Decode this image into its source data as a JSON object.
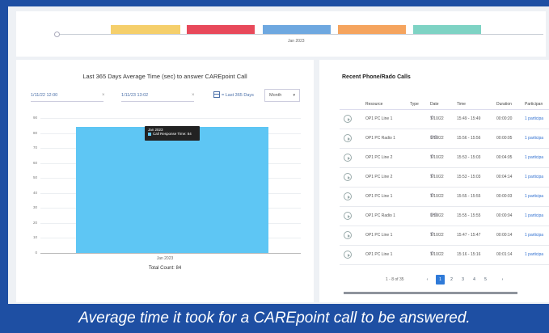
{
  "timeline": {
    "label": "Jan 2023",
    "segments": [
      "#f5cf6b",
      "#e8495a",
      "#6ea8e0",
      "#f5a45e",
      "#7ed3c4"
    ]
  },
  "chart_panel": {
    "title": "Last 365 Days Average Time (sec) to answer CAREpoint Call",
    "start_date": "1/11/22 12:00",
    "end_date": "1/11/23 13:02",
    "range_label": "Last 365 Days",
    "interval": "Month",
    "total_count": "Total Count: 84"
  },
  "chart_data": {
    "type": "bar",
    "categories": [
      "Jan 2023"
    ],
    "series": [
      {
        "name": "Call Response Time",
        "values": [
          84
        ]
      }
    ],
    "ylim": [
      0,
      90
    ],
    "yticks": [
      0,
      10,
      20,
      30,
      40,
      50,
      60,
      70,
      80,
      90
    ],
    "tooltip": {
      "title": "Jan 2023",
      "line": "Call Response Time: 84"
    },
    "bar_color": "#5ec6f4"
  },
  "calls_panel": {
    "title": "Recent Phone/Rado Calls",
    "columns": [
      "Resource",
      "Type",
      "Date",
      "Time",
      "Duration",
      "Participan"
    ],
    "rows": [
      {
        "resource": "OP1 PC Line 1",
        "type": "phone",
        "date": "1/10/22",
        "time": "15:49 - 15:49",
        "duration": "00:00:20",
        "participants": "1 participa"
      },
      {
        "resource": "OP1 PC Radio 1",
        "type": "radio",
        "date": "1/10/22",
        "time": "15:56 - 15:56",
        "duration": "00:00:05",
        "participants": "1 participa"
      },
      {
        "resource": "OP1 PC Line 2",
        "type": "phone",
        "date": "1/10/22",
        "time": "15:53 - 15:03",
        "duration": "00:04:05",
        "participants": "1 participa"
      },
      {
        "resource": "OP1 PC Line 2",
        "type": "phone",
        "date": "1/10/22",
        "time": "15:53 - 15:03",
        "duration": "00:04:14",
        "participants": "1 participa"
      },
      {
        "resource": "OP1 PC Line 1",
        "type": "phone",
        "date": "1/10/22",
        "time": "15:55 - 15:55",
        "duration": "00:00:03",
        "participants": "1 participa"
      },
      {
        "resource": "OP1 PC Radio 1",
        "type": "radio",
        "date": "1/10/22",
        "time": "15:55 - 15:55",
        "duration": "00:00:04",
        "participants": "1 participa"
      },
      {
        "resource": "OP1 PC Line 1",
        "type": "phone",
        "date": "1/10/22",
        "time": "15:47 - 15:47",
        "duration": "00:00:14",
        "participants": "1 participa"
      },
      {
        "resource": "OP1 PC Line 1",
        "type": "phone",
        "date": "1/10/22",
        "time": "15:16 - 15:16",
        "duration": "00:01:14",
        "participants": "1 participa"
      }
    ],
    "pager": {
      "summary": "1 - 8 of 35",
      "prev": "‹",
      "pages": [
        "1",
        "2",
        "3",
        "4",
        "5"
      ],
      "active_page": "1",
      "next": "›"
    }
  },
  "caption": "Average time it took for a CAREpoint call to be answered."
}
